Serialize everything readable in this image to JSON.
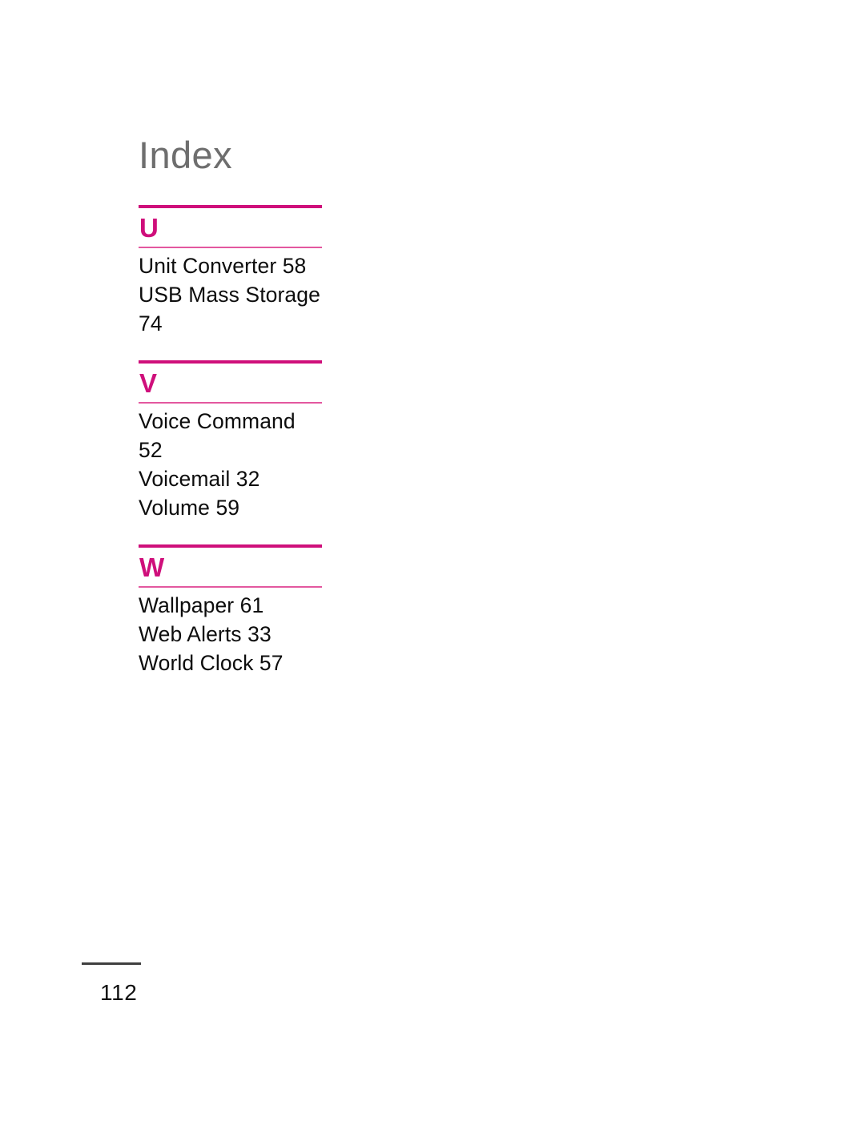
{
  "document": {
    "title": "Index",
    "page_number": "112",
    "accent_color": "#CF0F7B",
    "accent_light_color": "#E3589F",
    "title_color": "#6E6E6E",
    "text_color": "#0D0D0D",
    "footer_rule_color": "#3F3F3F",
    "background_color": "#FFFFFF"
  },
  "index": {
    "sections": [
      {
        "letter": "U",
        "entries": [
          "Unit Converter 58",
          "USB Mass Storage 74"
        ]
      },
      {
        "letter": "V",
        "entries": [
          "Voice Command 52",
          "Voicemail 32",
          "Volume 59"
        ]
      },
      {
        "letter": "W",
        "entries": [
          "Wallpaper 61",
          "Web Alerts 33",
          "World Clock 57"
        ]
      }
    ]
  }
}
